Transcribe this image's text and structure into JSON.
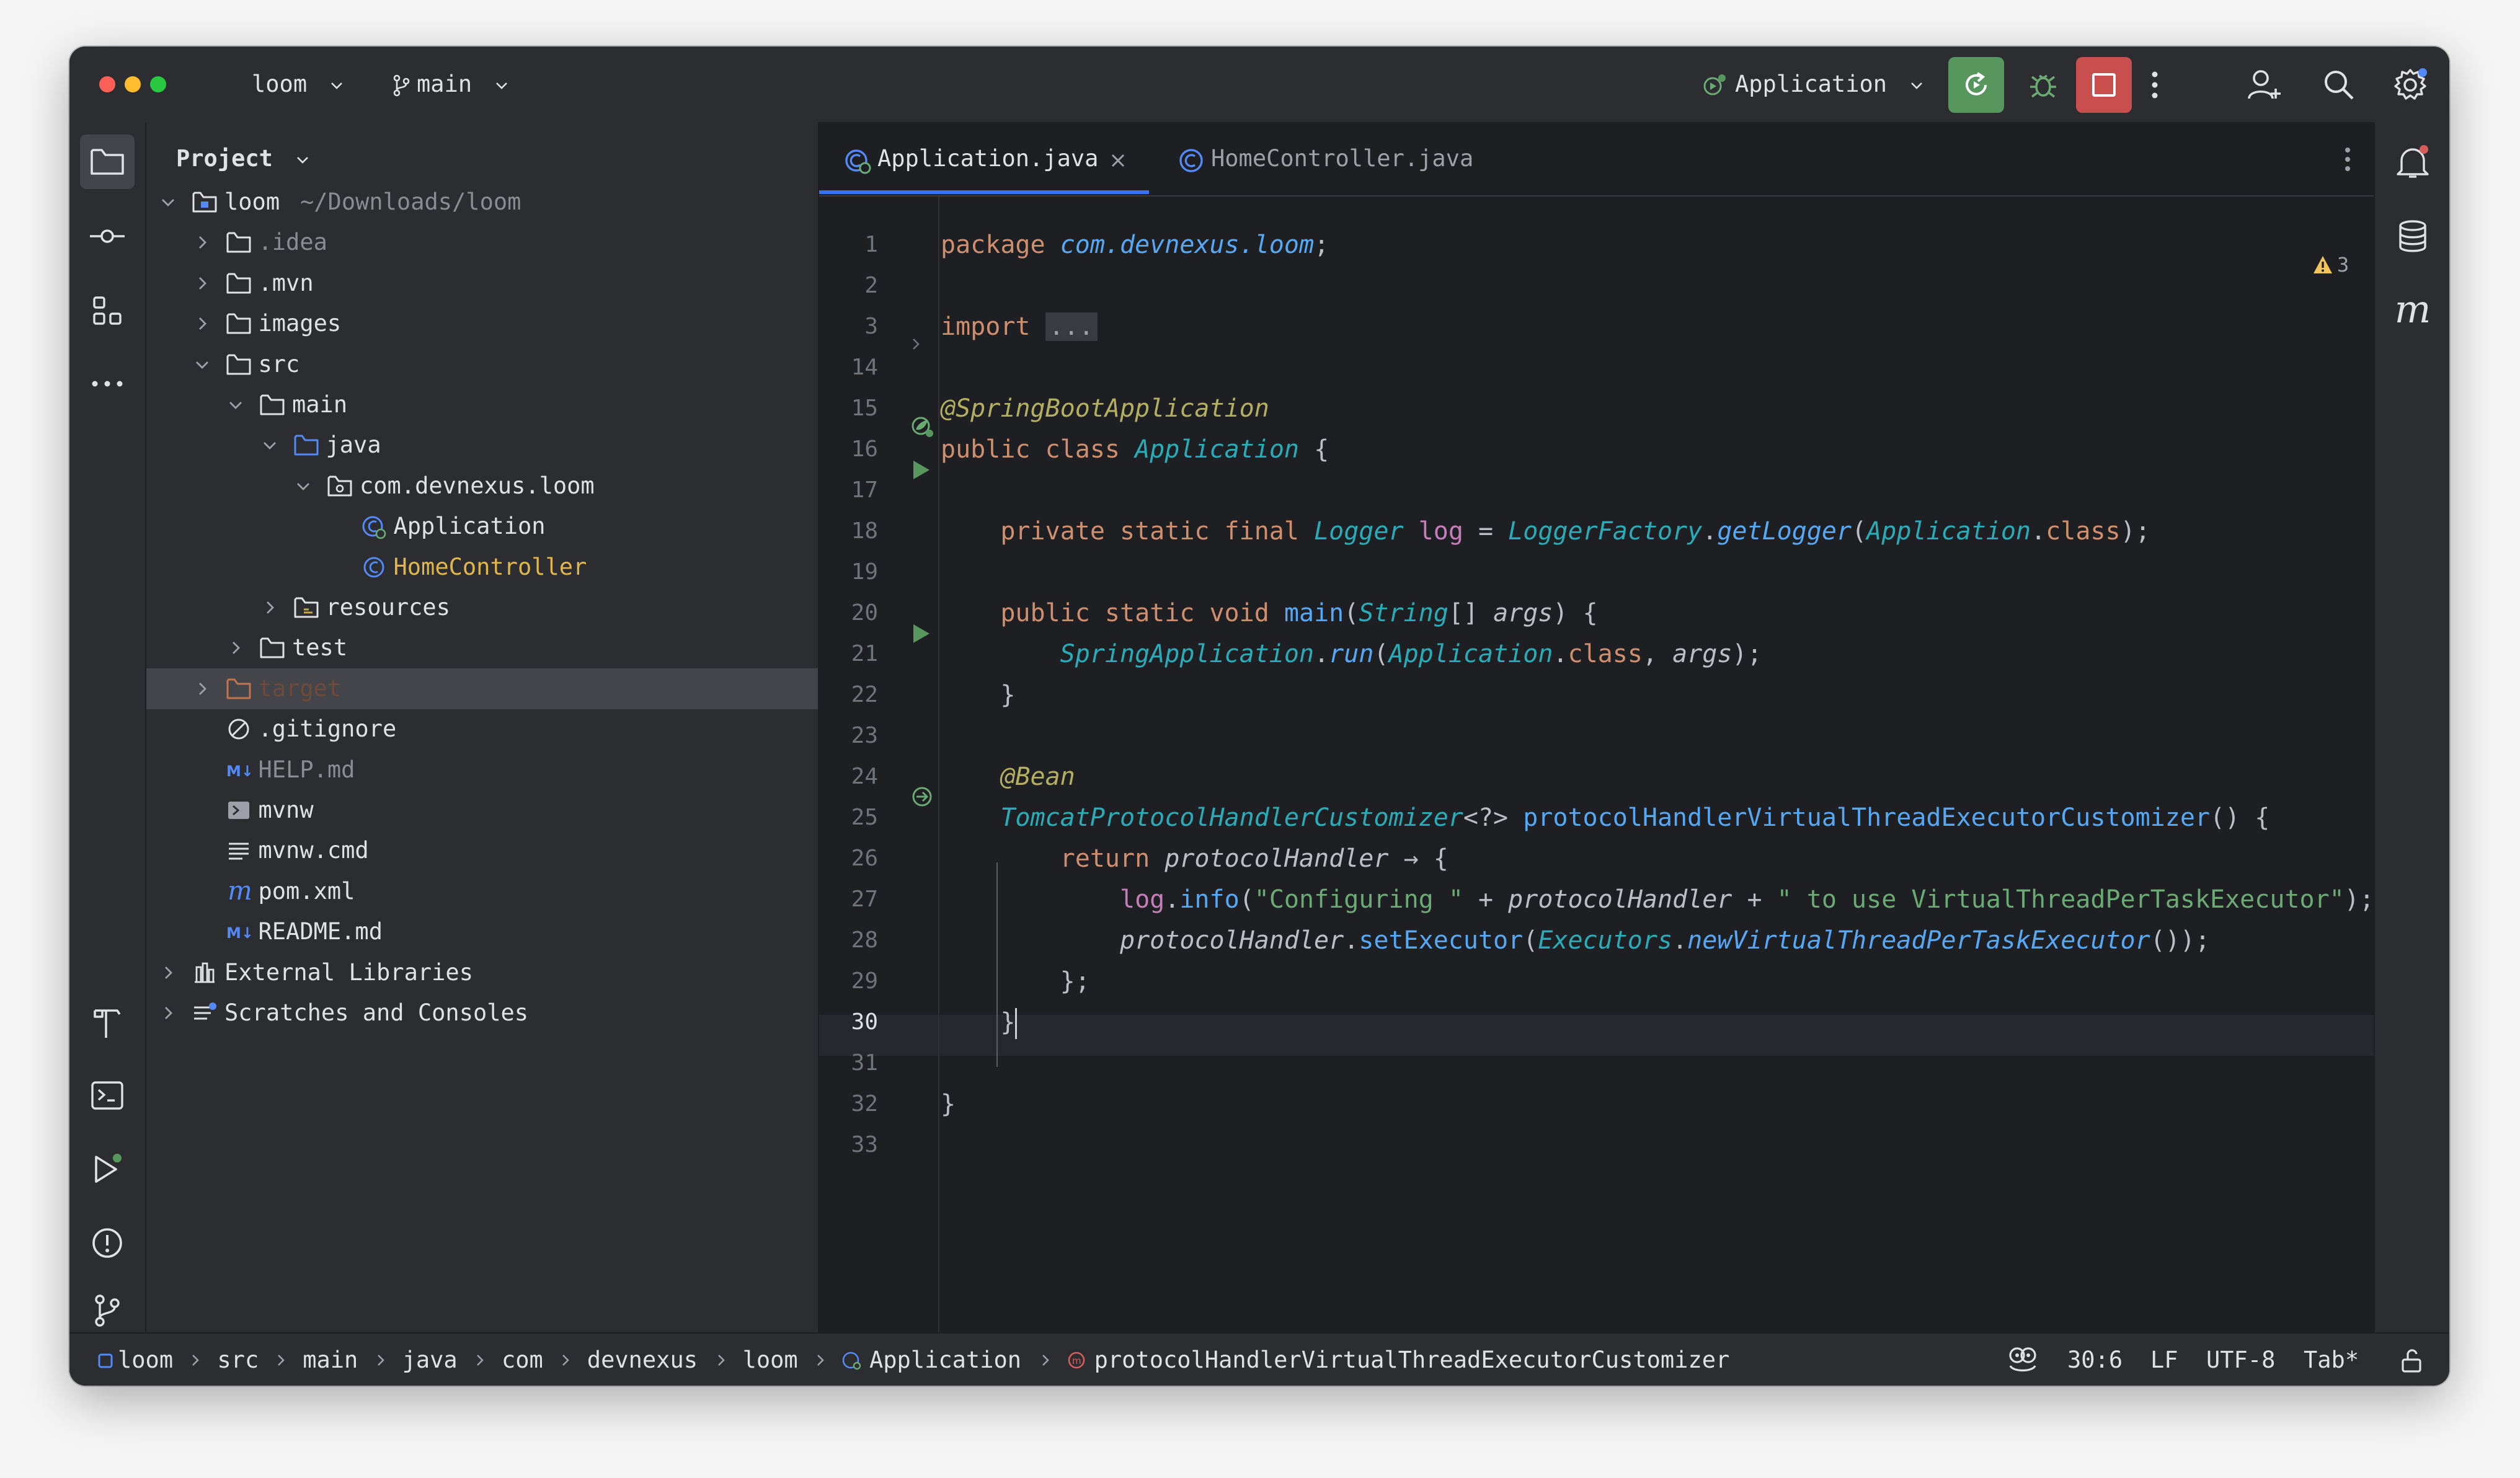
{
  "titlebar": {
    "project_name": "loom",
    "branch": "main",
    "run_config": "Application"
  },
  "project_panel": {
    "title": "Project",
    "tree": [
      {
        "label": "loom",
        "path": "~/Downloads/loom",
        "indent": 0,
        "expanded": true,
        "icon": "module-folder-icon"
      },
      {
        "label": ".idea",
        "indent": 1,
        "expanded": false,
        "icon": "folder-icon",
        "muted": true
      },
      {
        "label": ".mvn",
        "indent": 1,
        "expanded": false,
        "icon": "folder-icon"
      },
      {
        "label": "images",
        "indent": 1,
        "expanded": false,
        "icon": "folder-icon"
      },
      {
        "label": "src",
        "indent": 1,
        "expanded": true,
        "icon": "folder-icon"
      },
      {
        "label": "main",
        "indent": 2,
        "expanded": true,
        "icon": "folder-icon"
      },
      {
        "label": "java",
        "indent": 3,
        "expanded": true,
        "icon": "source-folder-icon"
      },
      {
        "label": "com.devnexus.loom",
        "indent": 4,
        "expanded": true,
        "icon": "package-icon"
      },
      {
        "label": "Application",
        "indent": 5,
        "icon": "spring-class-icon"
      },
      {
        "label": "HomeController",
        "indent": 5,
        "icon": "class-icon",
        "modified": true
      },
      {
        "label": "resources",
        "indent": 3,
        "expanded": false,
        "icon": "resources-folder-icon"
      },
      {
        "label": "test",
        "indent": 2,
        "expanded": false,
        "icon": "folder-icon"
      },
      {
        "label": "target",
        "indent": 1,
        "expanded": false,
        "icon": "excluded-folder-icon",
        "excluded": true,
        "selected": true
      },
      {
        "label": ".gitignore",
        "indent": 1,
        "icon": "ignore-file-icon"
      },
      {
        "label": "HELP.md",
        "indent": 1,
        "icon": "markdown-icon",
        "muted": true
      },
      {
        "label": "mvnw",
        "indent": 1,
        "icon": "shell-script-icon"
      },
      {
        "label": "mvnw.cmd",
        "indent": 1,
        "icon": "text-file-icon"
      },
      {
        "label": "pom.xml",
        "indent": 1,
        "icon": "maven-icon"
      },
      {
        "label": "README.md",
        "indent": 1,
        "icon": "markdown-icon"
      },
      {
        "label": "External Libraries",
        "indent": 0,
        "expanded": false,
        "icon": "library-icon"
      },
      {
        "label": "Scratches and Consoles",
        "indent": 0,
        "expanded": false,
        "icon": "scratches-icon"
      }
    ]
  },
  "editor": {
    "tabs": [
      {
        "label": "Application.java",
        "active": true
      },
      {
        "label": "HomeController.java",
        "active": false
      }
    ],
    "warning_count": "3",
    "current_line": "30",
    "lines": [
      {
        "n": "1",
        "t": [
          [
            "kw",
            "package "
          ],
          [
            "pkg",
            "com.devnexus.loom"
          ],
          [
            "cl",
            ";"
          ]
        ]
      },
      {
        "n": "2",
        "t": []
      },
      {
        "n": "3",
        "t": [
          [
            "kw",
            "import "
          ],
          [
            "fold",
            "..."
          ]
        ]
      },
      {
        "n": "14",
        "t": []
      },
      {
        "n": "15",
        "t": [
          [
            "ann",
            "@SpringBootApplication"
          ]
        ]
      },
      {
        "n": "16",
        "t": [
          [
            "kw",
            "public class "
          ],
          [
            "tyi",
            "Application"
          ],
          [
            "cl",
            " {"
          ]
        ]
      },
      {
        "n": "17",
        "t": []
      },
      {
        "n": "18",
        "t": [
          [
            "cl",
            "    "
          ],
          [
            "kw",
            "private static final "
          ],
          [
            "tyi",
            "Logger"
          ],
          [
            "cl",
            " "
          ],
          [
            "fld",
            "log"
          ],
          [
            "cl",
            " = "
          ],
          [
            "tyi",
            "LoggerFactory"
          ],
          [
            "cl",
            "."
          ],
          [
            "mthi",
            "getLogger"
          ],
          [
            "cl",
            "("
          ],
          [
            "tyi",
            "Application"
          ],
          [
            "cl",
            "."
          ],
          [
            "kw",
            "class"
          ],
          [
            "cl",
            ");"
          ]
        ]
      },
      {
        "n": "19",
        "t": []
      },
      {
        "n": "20",
        "t": [
          [
            "cl",
            "    "
          ],
          [
            "kw",
            "public static void "
          ],
          [
            "mth",
            "main"
          ],
          [
            "cl",
            "("
          ],
          [
            "tyi",
            "String"
          ],
          [
            "cl",
            "[] "
          ],
          [
            "pari",
            "args"
          ],
          [
            "cl",
            ") {"
          ]
        ]
      },
      {
        "n": "21",
        "t": [
          [
            "cl",
            "        "
          ],
          [
            "tyi",
            "SpringApplication"
          ],
          [
            "cl",
            "."
          ],
          [
            "mthi",
            "run"
          ],
          [
            "cl",
            "("
          ],
          [
            "tyi",
            "Application"
          ],
          [
            "cl",
            "."
          ],
          [
            "kw",
            "class"
          ],
          [
            "cl",
            ", "
          ],
          [
            "pari",
            "args"
          ],
          [
            "cl",
            ");"
          ]
        ]
      },
      {
        "n": "22",
        "t": [
          [
            "cl",
            "    }"
          ]
        ]
      },
      {
        "n": "23",
        "t": []
      },
      {
        "n": "24",
        "t": [
          [
            "cl",
            "    "
          ],
          [
            "ann",
            "@Bean"
          ]
        ]
      },
      {
        "n": "25",
        "t": [
          [
            "cl",
            "    "
          ],
          [
            "tyi",
            "TomcatProtocolHandlerCustomizer"
          ],
          [
            "cl",
            "<?> "
          ],
          [
            "mth",
            "protocolHandlerVirtualThreadExecutorCustomizer"
          ],
          [
            "cl",
            "() {"
          ]
        ]
      },
      {
        "n": "26",
        "t": [
          [
            "cl",
            "        "
          ],
          [
            "kw",
            "return "
          ],
          [
            "pari",
            "protocolHandler"
          ],
          [
            "cl",
            " → {"
          ]
        ]
      },
      {
        "n": "27",
        "t": [
          [
            "cl",
            "            "
          ],
          [
            "fld",
            "log"
          ],
          [
            "cl",
            "."
          ],
          [
            "mth",
            "info"
          ],
          [
            "cl",
            "("
          ],
          [
            "str",
            "\"Configuring \""
          ],
          [
            "cl",
            " + "
          ],
          [
            "pari",
            "protocolHandler"
          ],
          [
            "cl",
            " + "
          ],
          [
            "str",
            "\" to use VirtualThreadPerTaskExecutor\""
          ],
          [
            "cl",
            ");"
          ]
        ]
      },
      {
        "n": "28",
        "t": [
          [
            "cl",
            "            "
          ],
          [
            "pari",
            "protocolHandler"
          ],
          [
            "cl",
            "."
          ],
          [
            "mth",
            "setExecutor"
          ],
          [
            "cl",
            "("
          ],
          [
            "tyi",
            "Executors"
          ],
          [
            "cl",
            "."
          ],
          [
            "mthi",
            "newVirtualThreadPerTaskExecutor"
          ],
          [
            "cl",
            "());"
          ]
        ]
      },
      {
        "n": "29",
        "t": [
          [
            "cl",
            "        };"
          ]
        ]
      },
      {
        "n": "30",
        "t": [
          [
            "cl",
            "    }"
          ]
        ]
      },
      {
        "n": "31",
        "t": []
      },
      {
        "n": "32",
        "t": [
          [
            "cl",
            "}"
          ]
        ]
      },
      {
        "n": "33",
        "t": []
      }
    ]
  },
  "statusbar": {
    "breadcrumbs": [
      "loom",
      "src",
      "main",
      "java",
      "com",
      "devnexus",
      "loom",
      "Application",
      "protocolHandlerVirtualThreadExecutorCustomizer"
    ],
    "position": "30:6",
    "line_sep": "LF",
    "encoding": "UTF-8",
    "indent": "Tab*"
  },
  "colors": {
    "run_green": "#57965c",
    "stop_red": "#c94f4f",
    "accent_blue": "#548af7",
    "tab_underline": "#3574f0"
  }
}
